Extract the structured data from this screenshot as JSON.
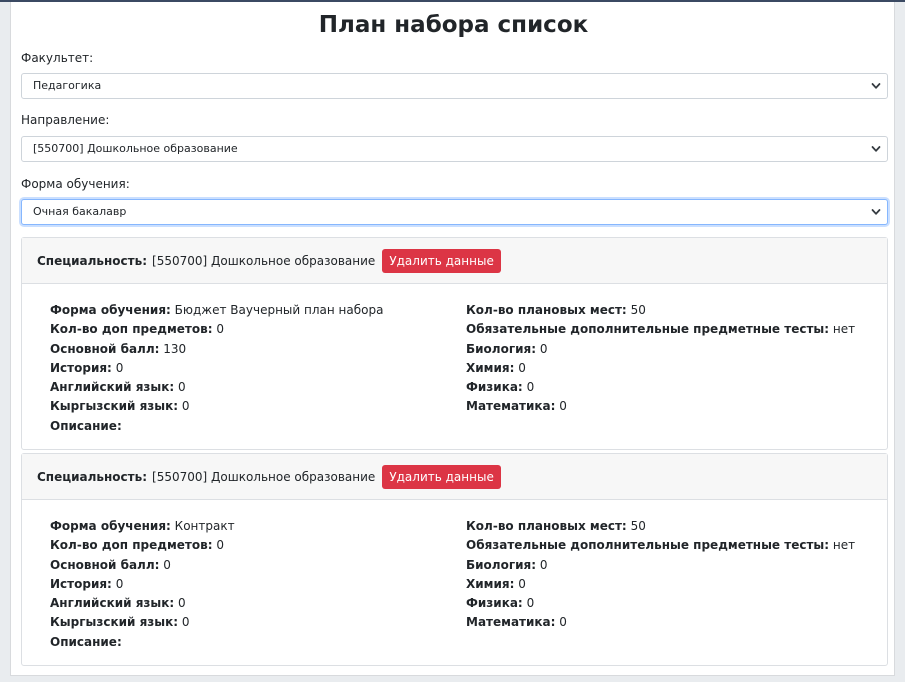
{
  "title": "План набора список",
  "fields": {
    "faculty": {
      "label": "Факультет:",
      "value": "Педагогика"
    },
    "direction": {
      "label": "Направление:",
      "value": "[550700] Дошкольное образование"
    },
    "study_form": {
      "label": "Форма обучения:",
      "value": "Очная бакалавр"
    }
  },
  "cards": [
    {
      "spec_label": "Специальность:",
      "spec_value": "[550700] Дошкольное образование",
      "delete_label": "Удалить данные",
      "left": [
        {
          "label": "Форма обучения:",
          "value": "Бюджет Ваучерный план набора"
        },
        {
          "label": "Кол-во доп предметов:",
          "value": "0"
        },
        {
          "label": "Основной балл:",
          "value": "130"
        },
        {
          "label": "История:",
          "value": "0"
        },
        {
          "label": "Английский язык:",
          "value": "0"
        },
        {
          "label": "Кыргызский язык:",
          "value": "0"
        },
        {
          "label": "Описание:",
          "value": ""
        }
      ],
      "right": [
        {
          "label": "Кол-во плановых мест:",
          "value": "50"
        },
        {
          "label": "Обязательные дополнительные предметные тесты:",
          "value": "нет"
        },
        {
          "label": "Биология:",
          "value": "0"
        },
        {
          "label": "Химия:",
          "value": "0"
        },
        {
          "label": "Физика:",
          "value": "0"
        },
        {
          "label": "Математика:",
          "value": "0"
        }
      ]
    },
    {
      "spec_label": "Специальность:",
      "spec_value": "[550700] Дошкольное образование",
      "delete_label": "Удалить данные",
      "left": [
        {
          "label": "Форма обучения:",
          "value": "Контракт"
        },
        {
          "label": "Кол-во доп предметов:",
          "value": "0"
        },
        {
          "label": "Основной балл:",
          "value": "0"
        },
        {
          "label": "История:",
          "value": "0"
        },
        {
          "label": "Английский язык:",
          "value": "0"
        },
        {
          "label": "Кыргызский язык:",
          "value": "0"
        },
        {
          "label": "Описание:",
          "value": ""
        }
      ],
      "right": [
        {
          "label": "Кол-во плановых мест:",
          "value": "50"
        },
        {
          "label": "Обязательные дополнительные предметные тесты:",
          "value": "нет"
        },
        {
          "label": "Биология:",
          "value": "0"
        },
        {
          "label": "Химия:",
          "value": "0"
        },
        {
          "label": "Физика:",
          "value": "0"
        },
        {
          "label": "Математика:",
          "value": "0"
        }
      ]
    }
  ]
}
